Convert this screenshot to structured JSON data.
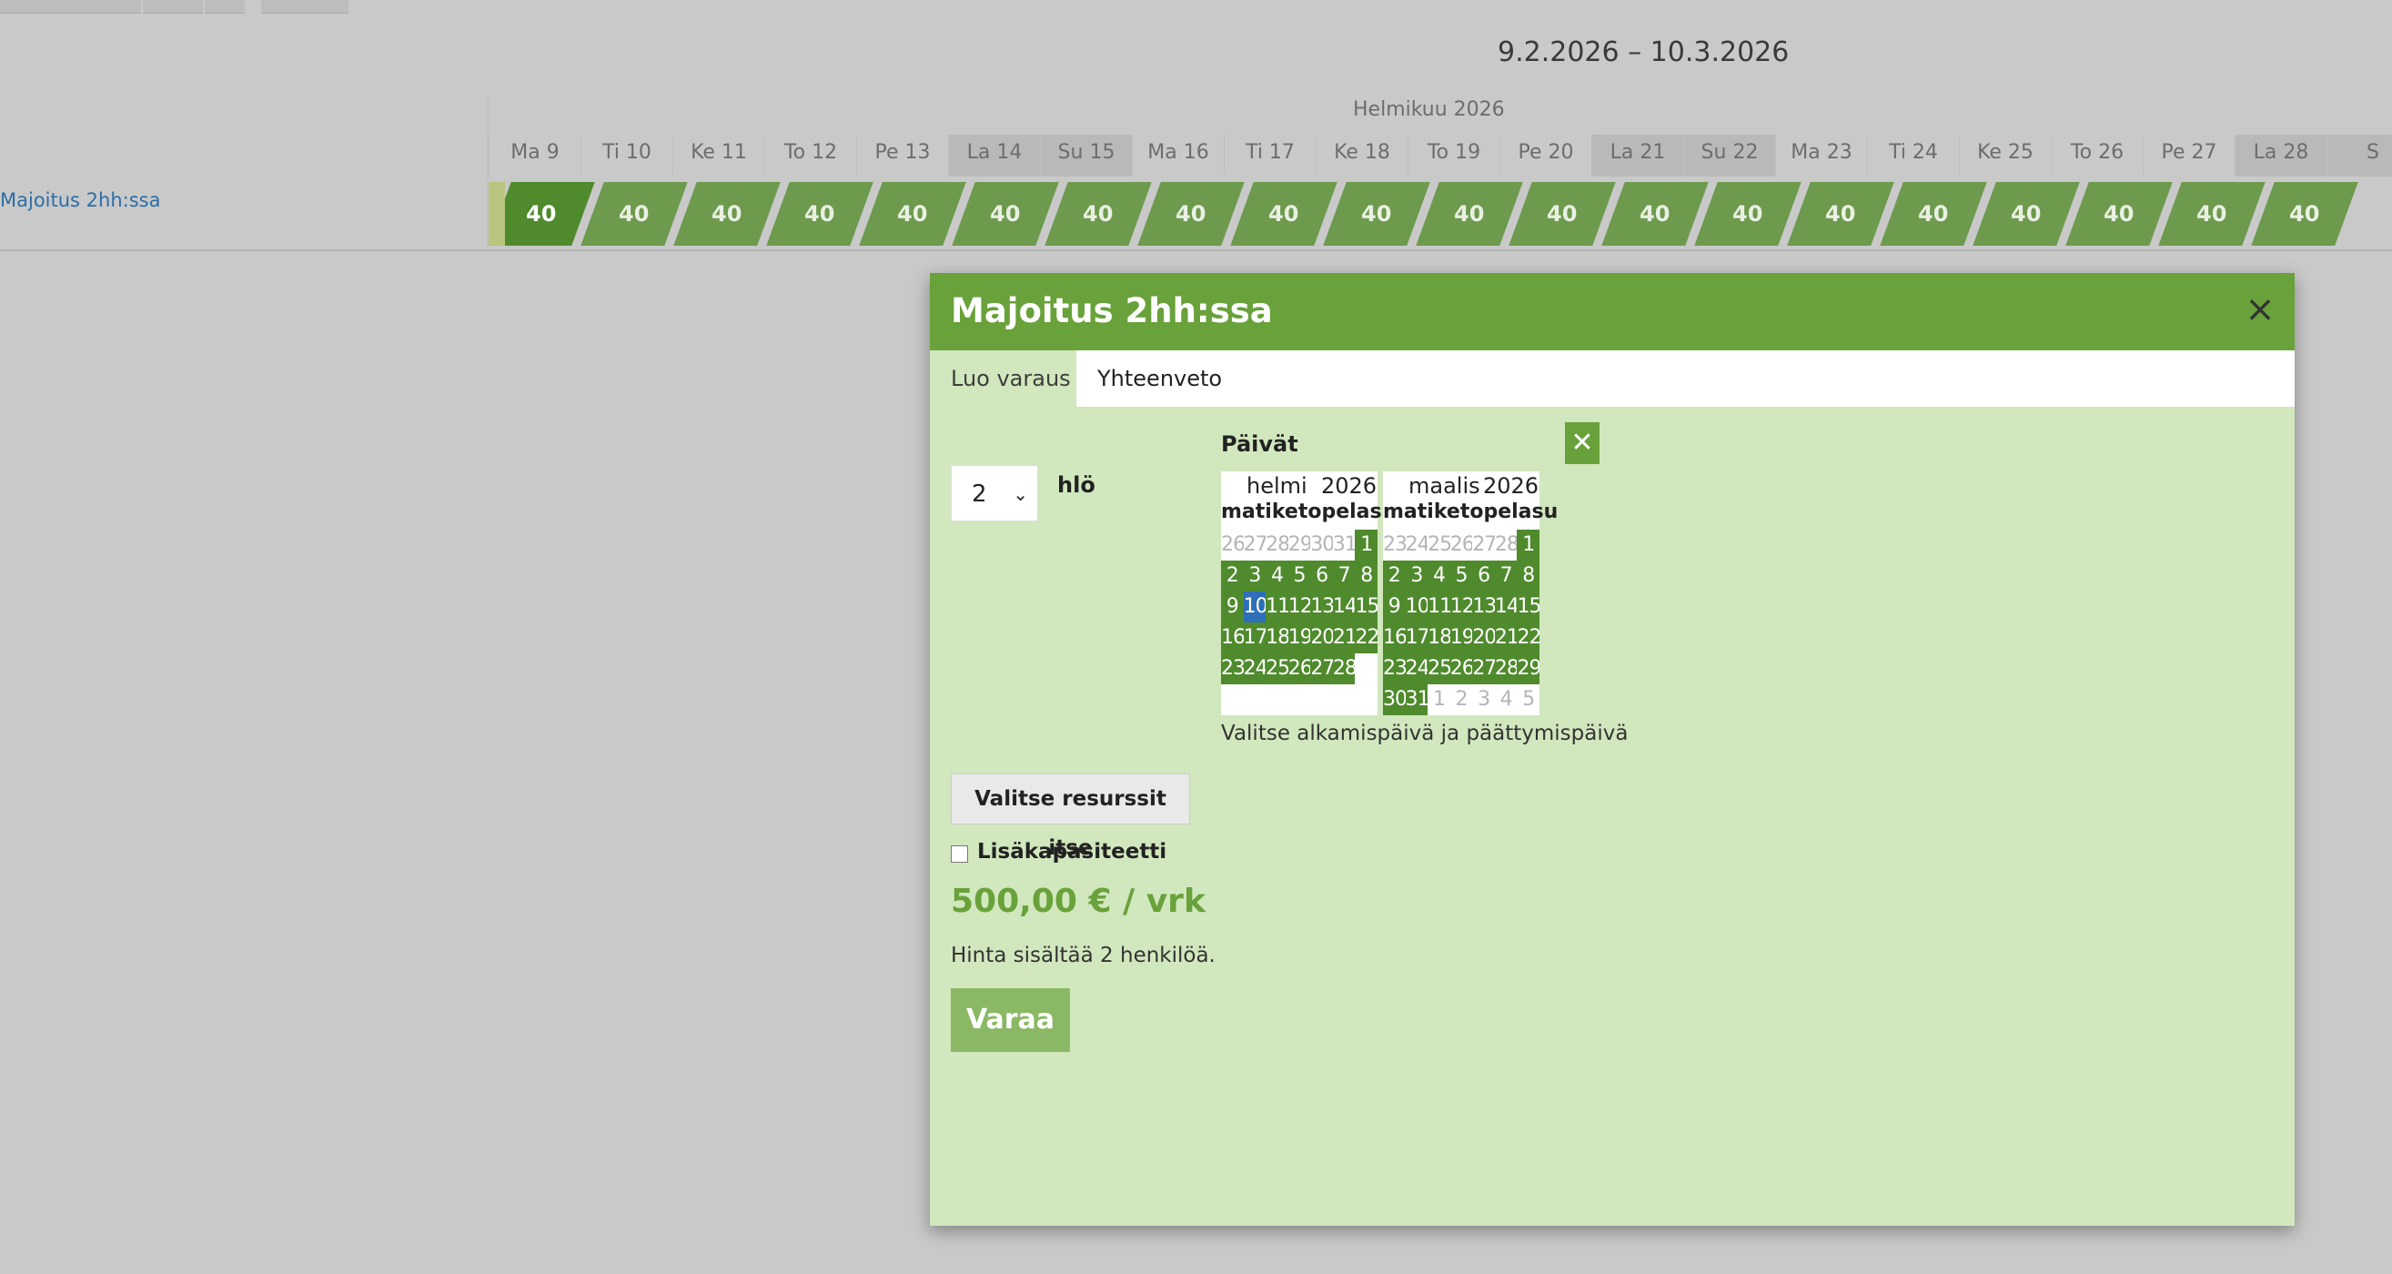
{
  "header": {
    "date_range": "9.2.2026 – 10.3.2026",
    "month_label": "Helmikuu 2026"
  },
  "timeline": {
    "days": [
      {
        "label": "Ma 9",
        "weekend": false
      },
      {
        "label": "Ti 10",
        "weekend": false
      },
      {
        "label": "Ke 11",
        "weekend": false
      },
      {
        "label": "To 12",
        "weekend": false
      },
      {
        "label": "Pe 13",
        "weekend": false
      },
      {
        "label": "La 14",
        "weekend": true
      },
      {
        "label": "Su 15",
        "weekend": true
      },
      {
        "label": "Ma 16",
        "weekend": false
      },
      {
        "label": "Ti 17",
        "weekend": false
      },
      {
        "label": "Ke 18",
        "weekend": false
      },
      {
        "label": "To 19",
        "weekend": false
      },
      {
        "label": "Pe 20",
        "weekend": false
      },
      {
        "label": "La 21",
        "weekend": true
      },
      {
        "label": "Su 22",
        "weekend": true
      },
      {
        "label": "Ma 23",
        "weekend": false
      },
      {
        "label": "Ti 24",
        "weekend": false
      },
      {
        "label": "Ke 25",
        "weekend": false
      },
      {
        "label": "To 26",
        "weekend": false
      },
      {
        "label": "Pe 27",
        "weekend": false
      },
      {
        "label": "La 28",
        "weekend": true
      },
      {
        "label": "S",
        "weekend": true
      }
    ],
    "resource_name": "Majoitus 2hh:ssa",
    "availability": [
      "40",
      "40",
      "40",
      "40",
      "40",
      "40",
      "40",
      "40",
      "40",
      "40",
      "40",
      "40",
      "40",
      "40",
      "40",
      "40",
      "40",
      "40",
      "40",
      "40"
    ]
  },
  "modal": {
    "title": "Majoitus 2hh:ssa",
    "tabs": {
      "create": "Luo varaus",
      "summary": "Yhteenveto"
    },
    "persons": {
      "value": "2",
      "unit": "hlö"
    },
    "dates_label": "Päivät",
    "clear_icon": "✕",
    "calendars": [
      {
        "month": "helmi",
        "year": "2026",
        "weekdays": [
          "ma",
          "ti",
          "ke",
          "to",
          "pe",
          "la",
          "su"
        ],
        "rows": [
          [
            {
              "d": "26",
              "s": "muted"
            },
            {
              "d": "27",
              "s": "muted"
            },
            {
              "d": "28",
              "s": "muted"
            },
            {
              "d": "29",
              "s": "muted"
            },
            {
              "d": "30",
              "s": "muted"
            },
            {
              "d": "31",
              "s": "muted"
            },
            {
              "d": "1",
              "s": "sel"
            }
          ],
          [
            {
              "d": "2",
              "s": "sel"
            },
            {
              "d": "3",
              "s": "sel"
            },
            {
              "d": "4",
              "s": "sel"
            },
            {
              "d": "5",
              "s": "sel"
            },
            {
              "d": "6",
              "s": "sel"
            },
            {
              "d": "7",
              "s": "sel"
            },
            {
              "d": "8",
              "s": "sel"
            }
          ],
          [
            {
              "d": "9",
              "s": "sel"
            },
            {
              "d": "10",
              "s": "today"
            },
            {
              "d": "11",
              "s": "sel"
            },
            {
              "d": "12",
              "s": "sel"
            },
            {
              "d": "13",
              "s": "sel"
            },
            {
              "d": "14",
              "s": "sel"
            },
            {
              "d": "15",
              "s": "sel"
            }
          ],
          [
            {
              "d": "16",
              "s": "sel"
            },
            {
              "d": "17",
              "s": "sel"
            },
            {
              "d": "18",
              "s": "sel"
            },
            {
              "d": "19",
              "s": "sel"
            },
            {
              "d": "20",
              "s": "sel"
            },
            {
              "d": "21",
              "s": "sel"
            },
            {
              "d": "22",
              "s": "sel"
            }
          ],
          [
            {
              "d": "23",
              "s": "sel"
            },
            {
              "d": "24",
              "s": "sel"
            },
            {
              "d": "25",
              "s": "sel"
            },
            {
              "d": "26",
              "s": "sel"
            },
            {
              "d": "27",
              "s": "sel"
            },
            {
              "d": "28",
              "s": "sel"
            },
            {
              "d": "",
              "s": "empty"
            }
          ],
          [
            {
              "d": "",
              "s": "empty"
            },
            {
              "d": "",
              "s": "empty"
            },
            {
              "d": "",
              "s": "empty"
            },
            {
              "d": "",
              "s": "empty"
            },
            {
              "d": "",
              "s": "empty"
            },
            {
              "d": "",
              "s": "empty"
            },
            {
              "d": "",
              "s": "empty"
            }
          ]
        ]
      },
      {
        "month": "maalis",
        "year": "2026",
        "weekdays": [
          "ma",
          "ti",
          "ke",
          "to",
          "pe",
          "la",
          "su"
        ],
        "rows": [
          [
            {
              "d": "23",
              "s": "muted"
            },
            {
              "d": "24",
              "s": "muted"
            },
            {
              "d": "25",
              "s": "muted"
            },
            {
              "d": "26",
              "s": "muted"
            },
            {
              "d": "27",
              "s": "muted"
            },
            {
              "d": "28",
              "s": "muted"
            },
            {
              "d": "1",
              "s": "sel"
            }
          ],
          [
            {
              "d": "2",
              "s": "sel"
            },
            {
              "d": "3",
              "s": "sel"
            },
            {
              "d": "4",
              "s": "sel"
            },
            {
              "d": "5",
              "s": "sel"
            },
            {
              "d": "6",
              "s": "sel"
            },
            {
              "d": "7",
              "s": "sel"
            },
            {
              "d": "8",
              "s": "sel"
            }
          ],
          [
            {
              "d": "9",
              "s": "sel"
            },
            {
              "d": "10",
              "s": "sel"
            },
            {
              "d": "11",
              "s": "sel"
            },
            {
              "d": "12",
              "s": "sel"
            },
            {
              "d": "13",
              "s": "sel"
            },
            {
              "d": "14",
              "s": "sel"
            },
            {
              "d": "15",
              "s": "sel"
            }
          ],
          [
            {
              "d": "16",
              "s": "sel"
            },
            {
              "d": "17",
              "s": "sel"
            },
            {
              "d": "18",
              "s": "sel"
            },
            {
              "d": "19",
              "s": "sel"
            },
            {
              "d": "20",
              "s": "sel"
            },
            {
              "d": "21",
              "s": "sel"
            },
            {
              "d": "22",
              "s": "sel"
            }
          ],
          [
            {
              "d": "23",
              "s": "sel"
            },
            {
              "d": "24",
              "s": "sel"
            },
            {
              "d": "25",
              "s": "sel"
            },
            {
              "d": "26",
              "s": "sel"
            },
            {
              "d": "27",
              "s": "sel"
            },
            {
              "d": "28",
              "s": "sel"
            },
            {
              "d": "29",
              "s": "sel"
            }
          ],
          [
            {
              "d": "30",
              "s": "sel"
            },
            {
              "d": "31",
              "s": "sel"
            },
            {
              "d": "1",
              "s": "muted"
            },
            {
              "d": "2",
              "s": "muted"
            },
            {
              "d": "3",
              "s": "muted"
            },
            {
              "d": "4",
              "s": "muted"
            },
            {
              "d": "5",
              "s": "muted"
            }
          ]
        ]
      }
    ],
    "date_hint": "Valitse alkamispäivä ja päättymispäivä",
    "choose_resources_label": "Valitse resurssit itse",
    "extra_capacity_label": "Lisäkapasiteetti",
    "price": "500,00 € / vrk",
    "price_note": "Hinta sisältää 2 henkilöä.",
    "book_label": "Varaa"
  },
  "colors": {
    "accent": "#69a13a",
    "cell": "#6d9a4d",
    "selected_day": "#4f8a2d",
    "today": "#2d6fb9",
    "link": "#2a6ea8"
  }
}
